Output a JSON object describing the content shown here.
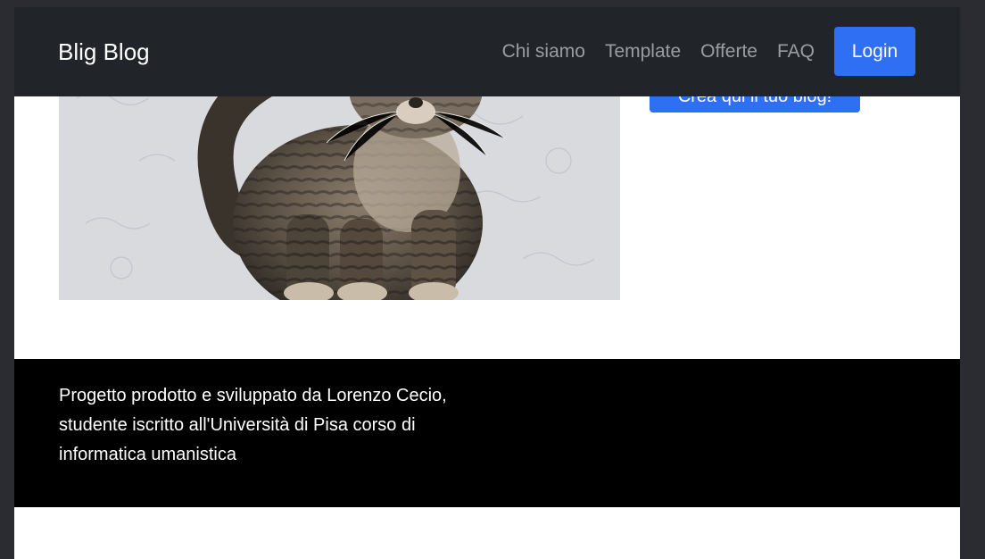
{
  "navbar": {
    "brand": "Blig Blog",
    "links": [
      "Chi siamo",
      "Template",
      "Offerte",
      "FAQ"
    ],
    "login_label": "Login"
  },
  "hero": {
    "image_icon": "kitten-photo",
    "cta_label": "Crea qui il tuo blog!"
  },
  "footer": {
    "text": "Progetto prodotto e sviluppato da Lorenzo Cecio, studente iscritto all'Università di Pisa corso di informatica umanistica"
  },
  "colors": {
    "navbar_bg": "#212529",
    "primary": "#2f6ff4",
    "footer_bg": "#000000"
  }
}
